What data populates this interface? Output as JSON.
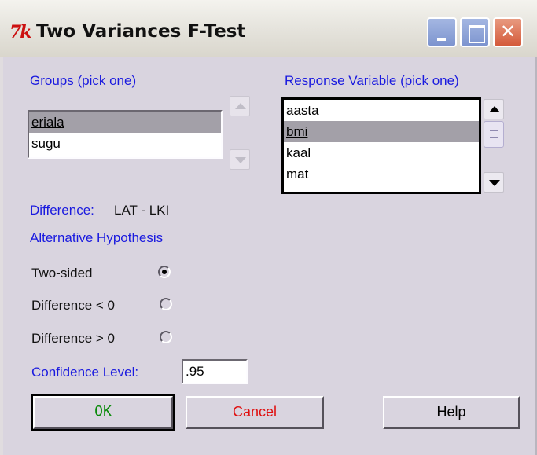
{
  "window": {
    "icon": "7k",
    "title": "Two Variances F-Test"
  },
  "groups": {
    "label": "Groups (pick one)",
    "items": [
      "eriala",
      "sugu"
    ],
    "selected": "eriala"
  },
  "response": {
    "label": "Response Variable (pick one)",
    "items": [
      "aasta",
      "bmi",
      "kaal",
      "mat"
    ],
    "selected": "bmi"
  },
  "difference": {
    "label": "Difference:",
    "value": "LAT - LKI"
  },
  "alternative": {
    "label": "Alternative Hypothesis",
    "options": [
      "Two-sided",
      "Difference < 0",
      "Difference > 0"
    ],
    "selected": "Two-sided"
  },
  "confidence": {
    "label": "Confidence Level:",
    "value": ".95"
  },
  "buttons": {
    "ok": "OK",
    "cancel": "Cancel",
    "help": "Help"
  },
  "colors": {
    "label_blue": "#1a1adf",
    "ok_text": "#0a8a0a",
    "cancel_text": "#e01010",
    "dialog_bg": "#d9d4df",
    "selection_bg": "#a3a0a8"
  },
  "icons": [
    "tk-app-icon",
    "minimize-icon",
    "maximize-icon",
    "close-icon",
    "scroll-up-icon",
    "scroll-down-icon"
  ]
}
